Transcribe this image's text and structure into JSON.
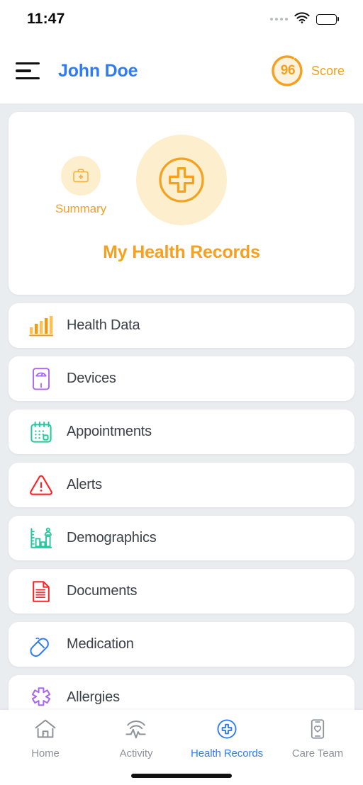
{
  "status_bar": {
    "time": "11:47",
    "cellular_icon": "signal-dots-icon",
    "wifi_icon": "wifi-icon",
    "battery_icon": "battery-full-icon"
  },
  "header": {
    "menu_icon": "hamburger-menu-icon",
    "user_name": "John Doe",
    "score_value": "96",
    "score_label": "Score",
    "accent_color": "#f5a01e",
    "name_color": "#2f7bf6"
  },
  "hero": {
    "summary_label": "Summary",
    "summary_icon": "medical-briefcase-icon",
    "main_icon": "medical-cross-circle-icon",
    "title": "My Health Records",
    "bubble_color": "#fdeecd"
  },
  "records": [
    {
      "label": "Health Data",
      "icon": "bar-chart-icon",
      "color": "#f5a01e"
    },
    {
      "label": "Devices",
      "icon": "weight-scale-icon",
      "color": "#a966f0"
    },
    {
      "label": "Appointments",
      "icon": "calendar-icon",
      "color": "#21c99d"
    },
    {
      "label": "Alerts",
      "icon": "warning-triangle-icon",
      "color": "#fb2323"
    },
    {
      "label": "Demographics",
      "icon": "demographics-chart-icon",
      "color": "#21c99d"
    },
    {
      "label": "Documents",
      "icon": "document-icon",
      "color": "#fb2323"
    },
    {
      "label": "Medication",
      "icon": "pill-capsule-icon",
      "color": "#2f7bf6"
    },
    {
      "label": "Allergies",
      "icon": "allergy-star-icon",
      "color": "#a966f0"
    }
  ],
  "tabs": [
    {
      "label": "Home",
      "icon": "home-icon",
      "active": false
    },
    {
      "label": "Activity",
      "icon": "activity-pulse-icon",
      "active": false
    },
    {
      "label": "Health Records",
      "icon": "health-records-icon",
      "active": true
    },
    {
      "label": "Care Team",
      "icon": "phone-heart-icon",
      "active": false
    }
  ],
  "colors": {
    "page_background": "#eaedf0",
    "card_background": "#ffffff",
    "active_tab": "#2f7bf6",
    "inactive_tab": "#8d9299",
    "label_text": "#3b4149"
  }
}
